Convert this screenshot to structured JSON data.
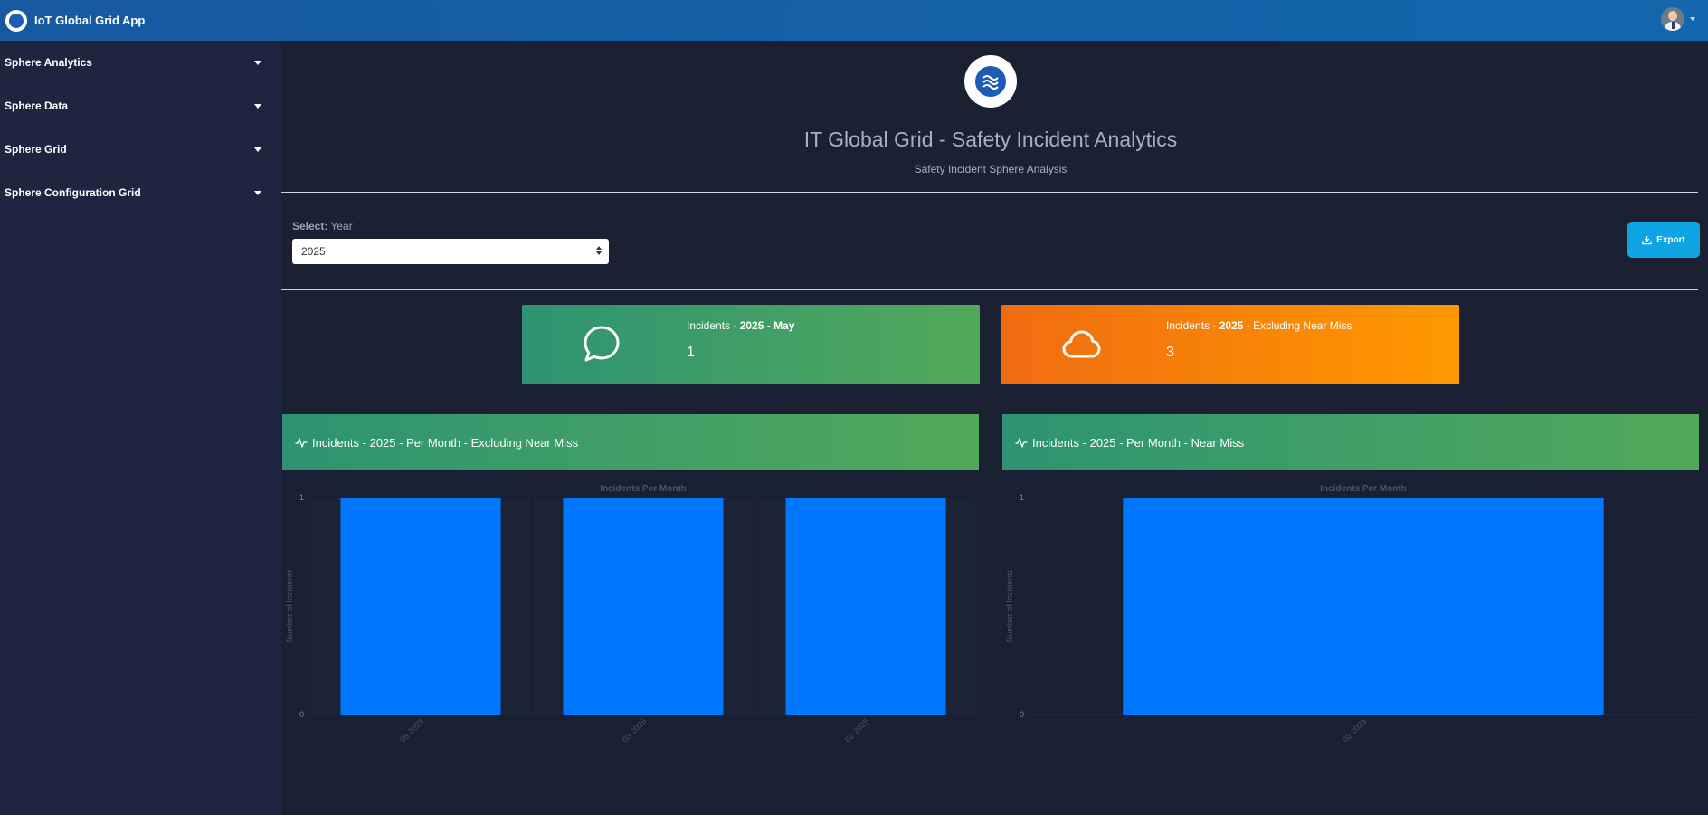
{
  "app": {
    "title": "IoT Global Grid App"
  },
  "sidebar": {
    "items": [
      {
        "label": "Sphere Analytics"
      },
      {
        "label": "Sphere Data"
      },
      {
        "label": "Sphere Grid"
      },
      {
        "label": "Sphere Configuration Grid"
      }
    ]
  },
  "header": {
    "title": "IT Global Grid - Safety Incident Analytics",
    "subtitle": "Safety Incident Sphere Analysis"
  },
  "filter": {
    "label_bold": "Select:",
    "label": "Year",
    "selected": "2025"
  },
  "toolbar": {
    "export_label": "Export"
  },
  "kpis": [
    {
      "title_pre": "Incidents - ",
      "title_bold": "2025 - May",
      "title_post": "",
      "value": "1",
      "icon": "speech-bubble-icon"
    },
    {
      "title_pre": "Incidents - ",
      "title_bold": "2025",
      "title_post": " - Excluding Near Miss",
      "value": "3",
      "icon": "cloud-icon"
    }
  ],
  "panels": [
    {
      "title": "Incidents - 2025 - Per Month - Excluding Near Miss",
      "icon": "activity-icon"
    },
    {
      "title": "Incidents - 2025 - Per Month - Near Miss",
      "icon": "activity-icon"
    }
  ],
  "colors": {
    "bar": "#0077ff",
    "topbar": "#1467ad",
    "sidebar": "#1e2540",
    "background": "#1b2033",
    "kpi_green": "#3a9d66",
    "kpi_orange": "#f7810b",
    "export": "#0ea3e3"
  },
  "chart_data": [
    {
      "type": "bar",
      "title": "Incidents Per Month",
      "ylabel": "Number of Incidents",
      "xlabel": "",
      "categories": [
        "05-2025",
        "03-2025",
        "02-2025"
      ],
      "values": [
        1,
        1,
        1
      ],
      "ylim": [
        0,
        1
      ],
      "yticks": [
        "0",
        "1"
      ],
      "grid": false
    },
    {
      "type": "bar",
      "title": "Incidents Per Month",
      "ylabel": "Number of Incidents",
      "xlabel": "",
      "categories": [
        "02-2025"
      ],
      "values": [
        1
      ],
      "ylim": [
        0,
        1
      ],
      "yticks": [
        "0",
        "1"
      ],
      "grid": false
    }
  ]
}
